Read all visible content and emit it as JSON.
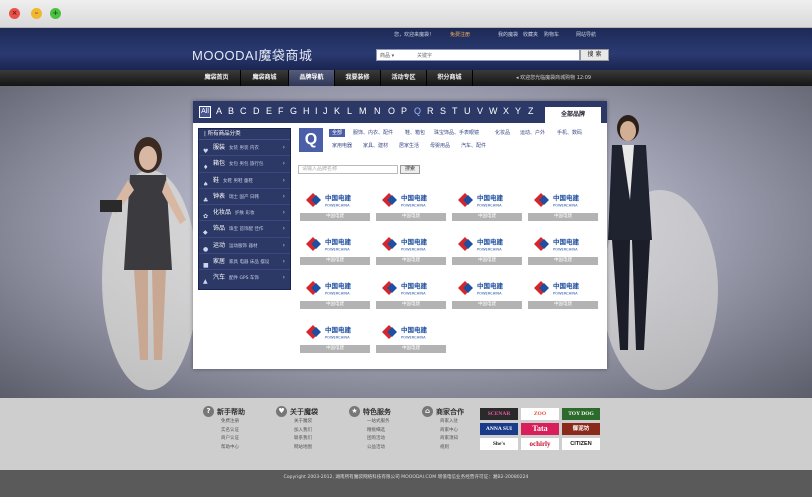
{
  "window": {
    "close": "×",
    "minimize": "–",
    "zoom": "+"
  },
  "header": {
    "logo": "MOOODAI魔袋商城",
    "welcome": "您，欢迎来魔袋！",
    "register": "免费注册",
    "links": [
      "我的魔袋",
      "收藏夹",
      "购物车",
      "网站导航"
    ],
    "search_category": "商品 ▾",
    "search_placeholder": "关键字",
    "search_button": "搜 索"
  },
  "nav": {
    "items": [
      "魔袋首页",
      "魔袋商城",
      "品牌导航",
      "我要装修",
      "活动专区",
      "积分商城"
    ],
    "notice": "欢迎您光临魔袋商城购物 12:09"
  },
  "brands": {
    "letters_all": "All",
    "letters": [
      "A",
      "B",
      "C",
      "D",
      "E",
      "F",
      "G",
      "H",
      "I",
      "J",
      "K",
      "L",
      "M",
      "N",
      "O",
      "P",
      "Q",
      "R",
      "S",
      "T",
      "U",
      "V",
      "W",
      "X",
      "Y",
      "Z"
    ],
    "all_brands_tab": "全部品牌",
    "side_title": "| 所有商品分类",
    "side": [
      {
        "icon": "♥",
        "name": "服装",
        "sub": "女装 男装 内衣"
      },
      {
        "icon": "♦",
        "name": "箱包",
        "sub": "女包 男包 旅行包"
      },
      {
        "icon": "♠",
        "name": "鞋",
        "sub": "女鞋 男鞋 童鞋"
      },
      {
        "icon": "♣",
        "name": "钟表",
        "sub": "瑞士 国产 日韩"
      },
      {
        "icon": "✿",
        "name": "化妆品",
        "sub": "护肤 彩妆"
      },
      {
        "icon": "◆",
        "name": "饰品",
        "sub": "珠宝 首饰配 佳作"
      },
      {
        "icon": "●",
        "name": "运动",
        "sub": "运动服饰 器材"
      },
      {
        "icon": "■",
        "name": "家居",
        "sub": "家具 电器 床品 摆设"
      },
      {
        "icon": "▲",
        "name": "汽车",
        "sub": "配件 GPS 车饰"
      }
    ],
    "q_letter": "Q",
    "categories_row1": [
      "全部",
      "服饰、内衣、配件",
      "鞋、箱包",
      "珠宝饰品、手表眼镜",
      "化妆品",
      "运动、户外",
      "手机、数码"
    ],
    "categories_row2": [
      "家用电器",
      "家具、建材",
      "居家生活",
      "母婴用品",
      "汽车、配件"
    ],
    "brand_search_placeholder": "请输入品牌名称",
    "brand_search_button": "搜索",
    "logo_text_cn": "中国电建",
    "logo_text_en": "POWERCHINA",
    "items": [
      "中国电建",
      "中国电建",
      "中国电建",
      "中国电建",
      "中国电建",
      "中国电建",
      "中国电建",
      "中国电建",
      "中国电建",
      "中国电建",
      "中国电建",
      "中国电建",
      "中国电建",
      "中国电建"
    ]
  },
  "footer": {
    "cols": [
      {
        "icon": "?",
        "title": "新手帮助",
        "links": [
          "免费注册",
          "实名认证",
          "商户认证",
          "帮助中心"
        ]
      },
      {
        "icon": "♥",
        "title": "关于魔袋",
        "links": [
          "关于魔袋",
          "加入我们",
          "联系我们",
          "网站地图"
        ]
      },
      {
        "icon": "★",
        "title": "特色服务",
        "links": [
          "一站式服务",
          "精挑细选",
          "团购活动",
          "公益活动"
        ]
      },
      {
        "icon": "⌂",
        "title": "商家合作",
        "links": [
          "商家入驻",
          "商家中心",
          "商家须知",
          "规则"
        ]
      }
    ],
    "partners": [
      "SCENAR",
      "ZOO",
      "TOY DOG",
      "ANNA SUI",
      "Tata",
      "御泥坊",
      "She's",
      "ochirly",
      "CITIZEN"
    ],
    "copyright": "Copyright 2003-2012, 湖南所有魔袋网络科技有限公司 MOOODAI.COM 增值电信业务经营许可证：湘B2-20080224"
  }
}
